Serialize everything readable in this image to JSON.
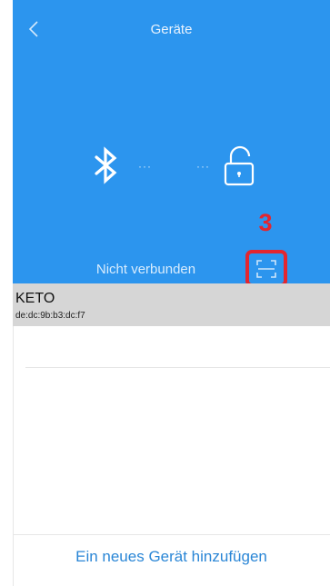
{
  "header": {
    "title": "Geräte",
    "back_icon": "chevron-left-icon",
    "bluetooth_icon": "bluetooth-icon",
    "lock_icon": "unlocked-padlock-icon",
    "dots_left": "···",
    "dots_right": "···",
    "annotation_number": "3",
    "status_text": "Nicht verbunden",
    "scan_icon": "scan-frame-icon",
    "colors": {
      "background": "#2c95ee",
      "annotation": "#e3262f"
    }
  },
  "devices": [
    {
      "name": "KETO",
      "mac": "de:dc:9b:b3:dc:f7"
    }
  ],
  "footer": {
    "add_device_label": "Ein neues Gerät hinzufügen",
    "accent": "#2a86d6"
  }
}
